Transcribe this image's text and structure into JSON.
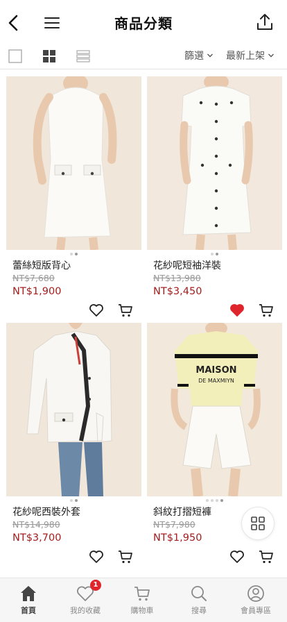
{
  "header": {
    "title": "商品分類",
    "back_icon": "chevron-left-icon",
    "menu_icon": "hamburger-icon",
    "share_icon": "share-icon"
  },
  "toolbar": {
    "filter_label": "篩選",
    "sort_label": "最新上架"
  },
  "products": [
    {
      "name": "蕾絲短版背心",
      "original_price": "NT$7,680",
      "price": "NT$1,900",
      "favorited": false,
      "image_count": 2,
      "image_index": 1
    },
    {
      "name": "花紗呢短袖洋裝",
      "original_price": "NT$13,980",
      "price": "NT$3,450",
      "favorited": true,
      "image_count": 2,
      "image_index": 1
    },
    {
      "name": "花紗呢西裝外套",
      "original_price": "NT$14,980",
      "price": "NT$3,700",
      "favorited": false,
      "image_count": 2,
      "image_index": 1
    },
    {
      "name": "斜紋打摺短褲",
      "original_price": "NT$7,980",
      "price": "NT$1,950",
      "favorited": false,
      "image_count": 4,
      "image_index": 3
    }
  ],
  "tabbar": {
    "items": [
      {
        "label": "首頁",
        "icon": "home-icon",
        "active": true
      },
      {
        "label": "我的收藏",
        "icon": "heart-icon",
        "active": false,
        "badge": "1"
      },
      {
        "label": "購物車",
        "icon": "cart-icon",
        "active": false
      },
      {
        "label": "搜尋",
        "icon": "search-icon",
        "active": false
      },
      {
        "label": "會員專區",
        "icon": "user-icon",
        "active": false
      }
    ]
  },
  "colors": {
    "price_red": "#a51d1d",
    "heart_red": "#e0242b",
    "badge_red": "#e0242b"
  }
}
